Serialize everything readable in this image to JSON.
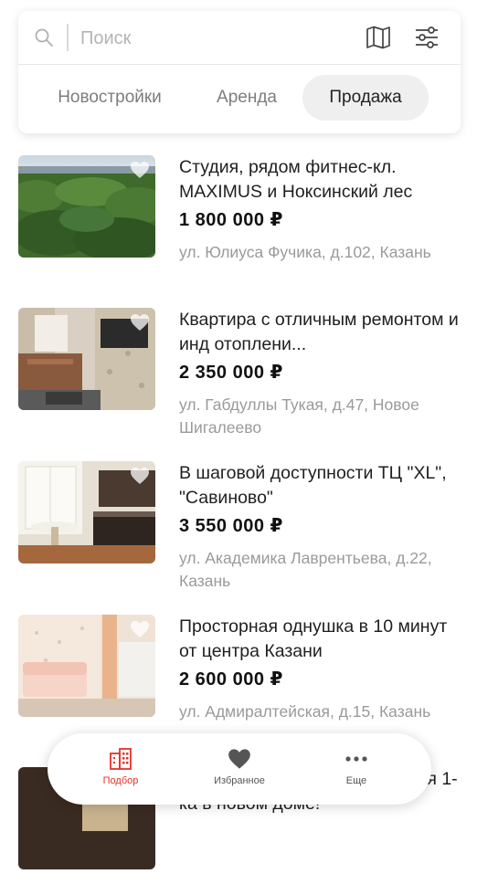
{
  "search": {
    "placeholder": "Поиск"
  },
  "tabs": [
    {
      "label": "Новостройки",
      "active": false
    },
    {
      "label": "Аренда",
      "active": false
    },
    {
      "label": "Продажа",
      "active": true
    }
  ],
  "listings": [
    {
      "title": "Студия, рядом фитнес-кл. MAXIMUS и Ноксинский лес",
      "price": "1 800 000 ₽",
      "address": "ул. Юлиуса Фучика, д.102, Казань"
    },
    {
      "title": "Квартира с отличным ремонтом и инд отоплени...",
      "price": "2 350 000 ₽",
      "address": "ул. Габдуллы Тукая, д.47, Новое Шигалеево"
    },
    {
      "title": "В шаговой доступности ТЦ \"XL\", \"Савиново\"",
      "price": "3 550 000 ₽",
      "address": "ул. Академика Лаврентьева, д.22, Казань"
    },
    {
      "title": "Просторная однушка в 10 минут от центра Казани",
      "price": "2 600 000 ₽",
      "address": "ул. Адмиралтейская, д.15, Казань"
    },
    {
      "title": "Продается шикарная черновая 1-ка в новом доме!",
      "price": "",
      "address": ""
    }
  ],
  "bottom_nav": [
    {
      "label": "Подбор",
      "icon": "buildings-icon",
      "active": true
    },
    {
      "label": "Избранное",
      "icon": "heart-icon",
      "active": false
    },
    {
      "label": "Еще",
      "icon": "more-icon",
      "active": false
    }
  ],
  "colors": {
    "accent": "#e3322b",
    "price": "#111111",
    "address": "#9a9a9a"
  }
}
